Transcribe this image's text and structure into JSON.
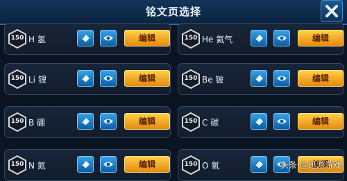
{
  "header": {
    "title": "铭文页选择"
  },
  "slots": [
    {
      "level": "150",
      "name": "H 氢",
      "edit_label": "编辑"
    },
    {
      "level": "150",
      "name": "He 氦气",
      "edit_label": "编辑"
    },
    {
      "level": "150",
      "name": "Li 锂",
      "edit_label": "编辑"
    },
    {
      "level": "150",
      "name": "Be 铍",
      "edit_label": "编辑"
    },
    {
      "level": "150",
      "name": "B 硼",
      "edit_label": "编辑"
    },
    {
      "level": "150",
      "name": "C 碳",
      "edit_label": "编辑"
    },
    {
      "level": "150",
      "name": "N 氮",
      "edit_label": "编辑"
    },
    {
      "level": "150",
      "name": "O 氧",
      "edit_label": "编辑"
    }
  ],
  "watermark": "头条 @迅游游戏",
  "icons": {
    "close": "close-icon",
    "rename": "eraser-icon",
    "preview": "eye-icon"
  },
  "colors": {
    "accent": "#1e88d8",
    "edit_button": "#f5a623",
    "background": "#0b1422"
  }
}
